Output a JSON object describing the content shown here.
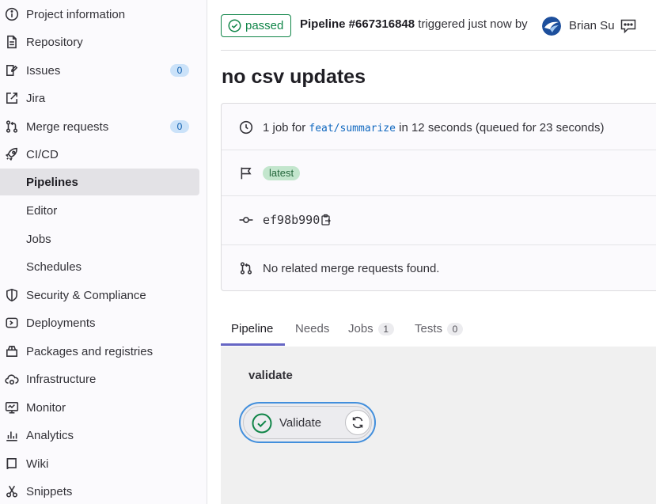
{
  "sidebar": {
    "items": [
      {
        "label": "Project information",
        "icon": "info-icon"
      },
      {
        "label": "Repository",
        "icon": "document-icon"
      },
      {
        "label": "Issues",
        "icon": "issues-icon",
        "count": "0"
      },
      {
        "label": "Jira",
        "icon": "external-link-icon"
      },
      {
        "label": "Merge requests",
        "icon": "merge-request-icon",
        "count": "0"
      },
      {
        "label": "CI/CD",
        "icon": "rocket-icon"
      },
      {
        "label": "Pipelines",
        "active": true
      },
      {
        "label": "Editor"
      },
      {
        "label": "Jobs"
      },
      {
        "label": "Schedules"
      },
      {
        "label": "Security & Compliance",
        "icon": "shield-icon"
      },
      {
        "label": "Deployments",
        "icon": "deployments-icon"
      },
      {
        "label": "Packages and registries",
        "icon": "package-icon"
      },
      {
        "label": "Infrastructure",
        "icon": "cloud-gear-icon"
      },
      {
        "label": "Monitor",
        "icon": "monitor-icon"
      },
      {
        "label": "Analytics",
        "icon": "chart-icon"
      },
      {
        "label": "Wiki",
        "icon": "book-icon"
      },
      {
        "label": "Snippets",
        "icon": "scissors-icon"
      }
    ]
  },
  "header": {
    "status": "passed",
    "pipeline_id": "Pipeline #667316848",
    "triggered_text": "triggered just now by",
    "user_name": "Brian Su"
  },
  "page": {
    "title": "no csv updates"
  },
  "info": {
    "job_count_text": "1 job for",
    "branch": "feat/summarize",
    "duration_text": "in 12 seconds (queued for 23 seconds)",
    "latest_badge": "latest",
    "commit_sha": "ef98b990",
    "merge_text": "No related merge requests found."
  },
  "tabs": [
    {
      "label": "Pipeline",
      "active": true
    },
    {
      "label": "Needs"
    },
    {
      "label": "Jobs",
      "count": "1"
    },
    {
      "label": "Tests",
      "count": "0"
    }
  ],
  "graph": {
    "stage": "validate",
    "job_name": "Validate",
    "job_status": "success"
  },
  "colors": {
    "success": "#108548",
    "link": "#1068bf",
    "active_tab": "#6666c4",
    "job_focus": "#428fdc"
  }
}
